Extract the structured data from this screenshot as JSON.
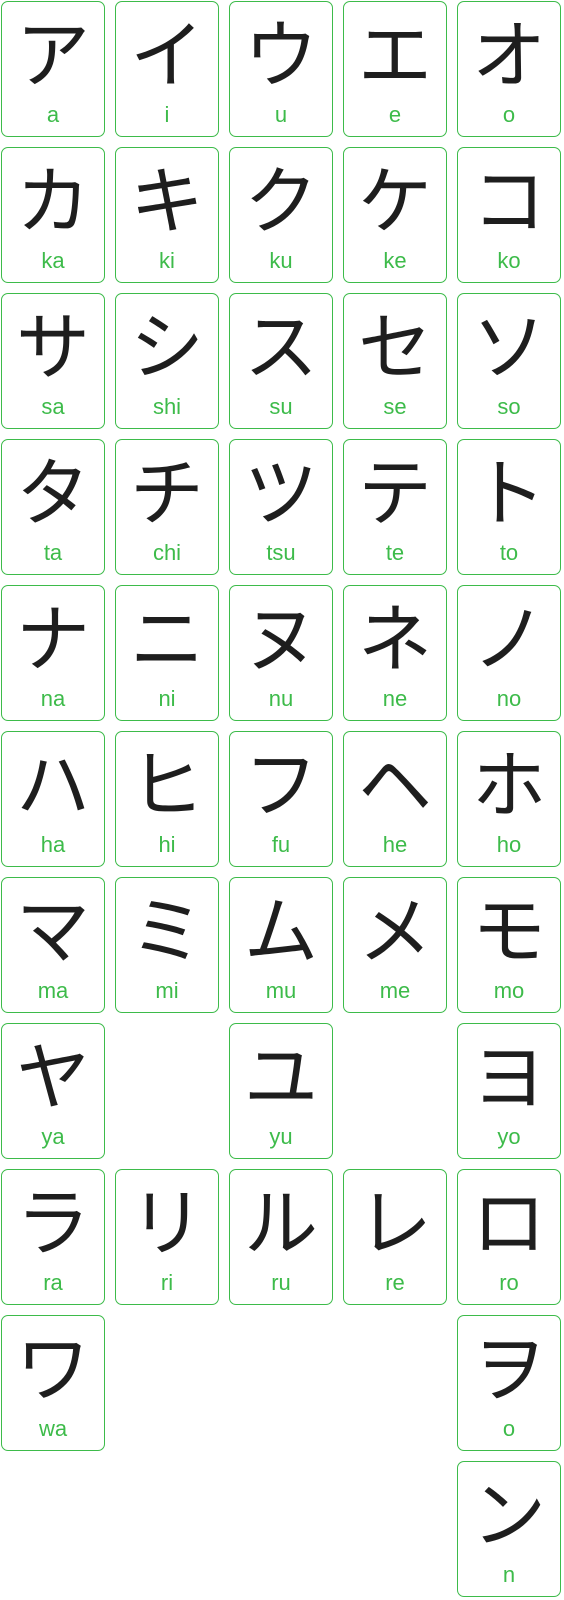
{
  "colors": {
    "border": "#3dbb4a",
    "romaji": "#3dbb4a",
    "kana": "#1e1e1e"
  },
  "rows": [
    [
      {
        "kana": "ア",
        "romaji": "a"
      },
      {
        "kana": "イ",
        "romaji": "i"
      },
      {
        "kana": "ウ",
        "romaji": "u"
      },
      {
        "kana": "エ",
        "romaji": "e"
      },
      {
        "kana": "オ",
        "romaji": "o"
      }
    ],
    [
      {
        "kana": "カ",
        "romaji": "ka"
      },
      {
        "kana": "キ",
        "romaji": "ki"
      },
      {
        "kana": "ク",
        "romaji": "ku"
      },
      {
        "kana": "ケ",
        "romaji": "ke"
      },
      {
        "kana": "コ",
        "romaji": "ko"
      }
    ],
    [
      {
        "kana": "サ",
        "romaji": "sa"
      },
      {
        "kana": "シ",
        "romaji": "shi"
      },
      {
        "kana": "ス",
        "romaji": "su"
      },
      {
        "kana": "セ",
        "romaji": "se"
      },
      {
        "kana": "ソ",
        "romaji": "so"
      }
    ],
    [
      {
        "kana": "タ",
        "romaji": "ta"
      },
      {
        "kana": "チ",
        "romaji": "chi"
      },
      {
        "kana": "ツ",
        "romaji": "tsu"
      },
      {
        "kana": "テ",
        "romaji": "te"
      },
      {
        "kana": "ト",
        "romaji": "to"
      }
    ],
    [
      {
        "kana": "ナ",
        "romaji": "na"
      },
      {
        "kana": "ニ",
        "romaji": "ni"
      },
      {
        "kana": "ヌ",
        "romaji": "nu"
      },
      {
        "kana": "ネ",
        "romaji": "ne"
      },
      {
        "kana": "ノ",
        "romaji": "no"
      }
    ],
    [
      {
        "kana": "ハ",
        "romaji": "ha"
      },
      {
        "kana": "ヒ",
        "romaji": "hi"
      },
      {
        "kana": "フ",
        "romaji": "fu"
      },
      {
        "kana": "ヘ",
        "romaji": "he"
      },
      {
        "kana": "ホ",
        "romaji": "ho"
      }
    ],
    [
      {
        "kana": "マ",
        "romaji": "ma"
      },
      {
        "kana": "ミ",
        "romaji": "mi"
      },
      {
        "kana": "ム",
        "romaji": "mu"
      },
      {
        "kana": "メ",
        "romaji": "me"
      },
      {
        "kana": "モ",
        "romaji": "mo"
      }
    ],
    [
      {
        "kana": "ヤ",
        "romaji": "ya"
      },
      null,
      {
        "kana": "ユ",
        "romaji": "yu"
      },
      null,
      {
        "kana": "ヨ",
        "romaji": "yo"
      }
    ],
    [
      {
        "kana": "ラ",
        "romaji": "ra"
      },
      {
        "kana": "リ",
        "romaji": "ri"
      },
      {
        "kana": "ル",
        "romaji": "ru"
      },
      {
        "kana": "レ",
        "romaji": "re"
      },
      {
        "kana": "ロ",
        "romaji": "ro"
      }
    ],
    [
      {
        "kana": "ワ",
        "romaji": "wa"
      },
      null,
      null,
      null,
      {
        "kana": "ヲ",
        "romaji": "o"
      }
    ],
    [
      null,
      null,
      null,
      null,
      {
        "kana": "ン",
        "romaji": "n"
      }
    ]
  ]
}
